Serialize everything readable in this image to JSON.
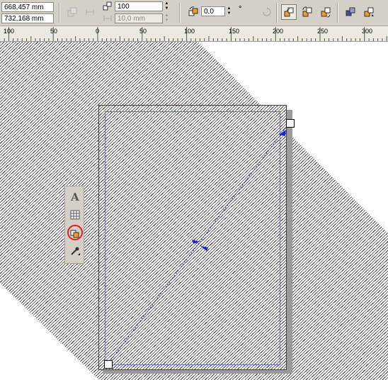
{
  "window": {
    "title": ""
  },
  "property_bar": {
    "position": {
      "x": "668,457 mm",
      "y": "732,168 mm"
    },
    "blend_steps": {
      "value": "100",
      "spacing": "10,0 mm"
    },
    "rotation": {
      "value": "0,0",
      "unit": "°"
    },
    "icons": {
      "preset_icon": "preset-list-icon",
      "steps_icon": "steps-icon",
      "spacing_icon": "spacing-icon",
      "rotation_icon": "rotation-icon",
      "loop_icon": "loop-blend-icon",
      "direct_blend": "direct-blend-icon",
      "clockwise_blend": "clockwise-blend-icon",
      "counterclockwise_blend": "counterclockwise-blend-icon",
      "object_color": "object-color-icon",
      "object_accel": "object-acceleration-icon"
    }
  },
  "ruler": {
    "labels": [
      "100",
      "50",
      "0",
      "50",
      "100",
      "150",
      "200",
      "250",
      "300"
    ]
  },
  "flyout": {
    "items": [
      {
        "icon": "artistic-text-icon",
        "glyph": "A"
      },
      {
        "icon": "table-icon"
      },
      {
        "icon": "interactive-blend-icon",
        "highlighted": true
      },
      {
        "icon": "eyedropper-icon"
      }
    ]
  },
  "colors": {
    "toolbar": "#d4d0c8",
    "blend_path": "#2222cc",
    "highlight_circle": "#e02020"
  }
}
